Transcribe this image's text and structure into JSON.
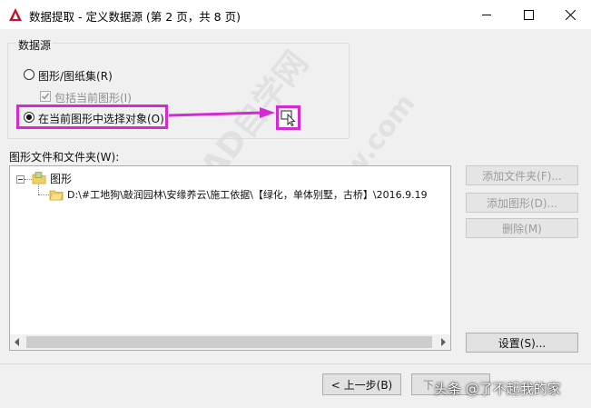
{
  "window": {
    "title": "数据提取 - 定义数据源 (第 2 页，共 8 页)",
    "icons": {
      "app": "autocad-logo-icon",
      "minimize": "minimize-icon",
      "maximize": "maximize-icon",
      "close": "close-icon"
    }
  },
  "data_source": {
    "legend": "数据源",
    "option_drawings": {
      "label": "图形/图纸集(R)",
      "selected": false
    },
    "include_current": {
      "label": "包括当前图形(I)",
      "checked": true,
      "enabled": false
    },
    "option_select_objects": {
      "label": "在当前图形中选择对象(O)",
      "selected": true
    },
    "select_objects_icon": "select-objects-icon"
  },
  "files": {
    "label": "图形文件和文件夹(W):",
    "tree": [
      {
        "label": "图形",
        "level": 0,
        "icon": "folder-icon"
      },
      {
        "label": "D:\\#工地狗\\敲润园林\\安缘养云\\施工依据\\【绿化，单体别墅，古桥】\\2016.9.19",
        "level": 1,
        "icon": "folder-icon"
      }
    ],
    "buttons": {
      "add_folder": "添加文件夹(F)...",
      "add_drawing": "添加图形(D)...",
      "remove": "删除(M)",
      "settings": "设置(S)..."
    }
  },
  "footer": {
    "back": "< 上一步(B)",
    "next": "下"
  },
  "watermark": {
    "line1": "CAD自学网",
    "line2": "www.cadzxw.com"
  },
  "overlay": {
    "text": "头条 @了不起我的家"
  },
  "colors": {
    "highlight": "#d42ad4",
    "accent": "#c8102e"
  }
}
